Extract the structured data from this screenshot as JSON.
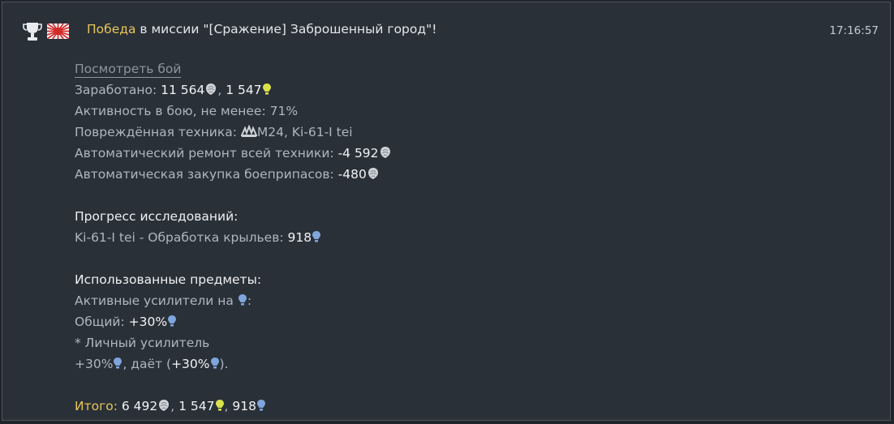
{
  "header": {
    "victory_word": "Победа",
    "message": " в миссии \"[Сражение] Заброшенный город\"!",
    "time": "17:16:57",
    "icons": [
      "trophy-icon",
      "japan-flag-icon"
    ]
  },
  "battle": {
    "view_battle_link": "Посмотреть бой",
    "earned_label": "Заработано: ",
    "earned_sl": "11 564",
    "earned_rp_sep": ", ",
    "earned_rp": "1 547",
    "activity": "Активность в бою, не менее: 71%",
    "damaged_label": "Повреждённая техника: ",
    "damaged_vehicles": "M24, Ki-61-I tei",
    "auto_repair_label": "Автоматический ремонт всей техники: ",
    "auto_repair_value": "-4 592",
    "auto_ammo_label": "Автоматическая закупка боеприпасов: ",
    "auto_ammo_value": "-480"
  },
  "research": {
    "heading": "Прогресс исследований:",
    "item_label": "Ki-61-I tei - Обработка крыльев: ",
    "item_value": "918"
  },
  "items": {
    "heading": "Использованные предметы:",
    "active_boosters_label": "Активные усилители на ",
    "active_boosters_colon": ":",
    "general_label": "Общий: ",
    "general_value": "+30%",
    "personal_booster": "* Личный усилитель",
    "personal_value": "+30%",
    "gives_label": ", даёт (",
    "gives_value": "+30%",
    "gives_close": ")."
  },
  "total": {
    "label": "Итого:",
    "sl": " 6 492",
    "sep1": ", ",
    "rp": "1 547",
    "sep2": ", ",
    "research": "918"
  },
  "colors": {
    "accent_gold": "#e6c65a",
    "sl_icon": "#cfd3d8",
    "rp_icon": "#d9e24a",
    "research_icon": "#7fa5dc"
  }
}
